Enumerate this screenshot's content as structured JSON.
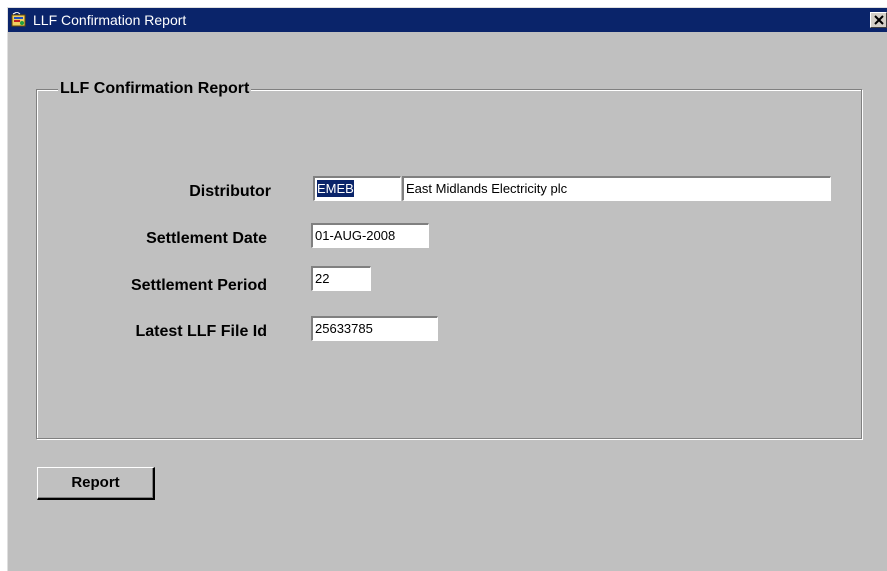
{
  "window": {
    "title": "LLF Confirmation Report",
    "close_glyph": "✕"
  },
  "group": {
    "title": "LLF Confirmation Report"
  },
  "fields": {
    "distributor": {
      "label": "Distributor",
      "code": "EMEB",
      "name": "East Midlands Electricity plc"
    },
    "settlement_date": {
      "label": "Settlement Date",
      "value": "01-AUG-2008"
    },
    "settlement_period": {
      "label": "Settlement Period",
      "value": "22"
    },
    "latest_llf_file_id": {
      "label": "Latest LLF File Id",
      "value": "25633785"
    }
  },
  "buttons": {
    "report": "Report"
  },
  "colors": {
    "titlebar": "#0a246a",
    "window_bg": "#c0c0c0",
    "selection": "#0a246a"
  },
  "icons": {
    "app": "app-icon",
    "close": "close-icon"
  }
}
